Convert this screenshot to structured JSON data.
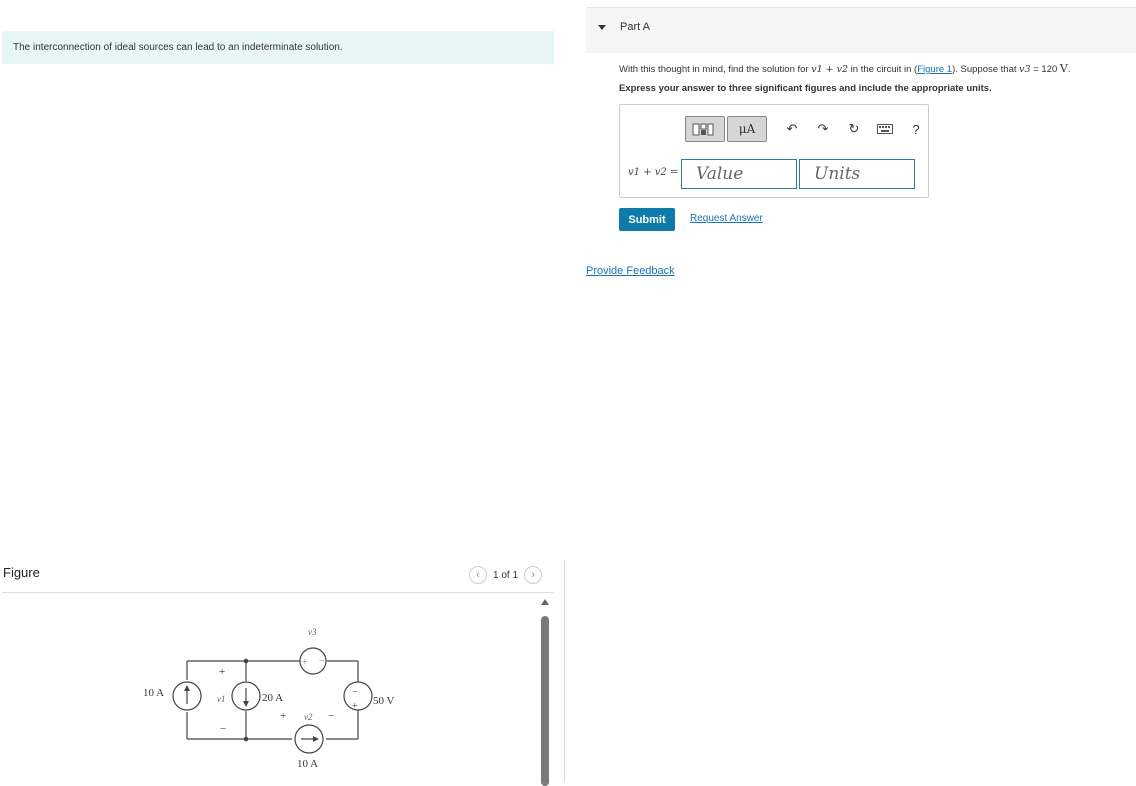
{
  "problem": {
    "intro": "The interconnection of ideal sources can lead to an indeterminate solution."
  },
  "figure": {
    "label": "Figure",
    "pager": "1 of 1",
    "circuit": {
      "labels": {
        "source_10a_left": "10 A",
        "v1_plus": "+",
        "v1": "v1",
        "v1_minus": "−",
        "source_20a": "20 A",
        "v3": "v3",
        "v3_plus": "+",
        "v3_minus": "−",
        "v2_plus": "+",
        "v2": "v2",
        "v2_minus": "−",
        "source_50v": "50 V",
        "s50_minus": "−",
        "s50_plus": "+",
        "source_10a_bottom": "10 A"
      }
    }
  },
  "partA": {
    "title": "Part A",
    "question_prefix": "With this thought in mind, find the solution for ",
    "question_expr": "v1 + v2",
    "question_mid": " in the circuit in (",
    "figure_link": "Figure 1",
    "question_suffix": "). Suppose that ",
    "given_var": "v3",
    "given_value": " = 120 ",
    "given_unit": "V",
    "question_end": ".",
    "instructions": "Express your answer to three significant figures and include the appropriate units.",
    "toolbar": {
      "units_button": "μA",
      "help": "?"
    },
    "answer": {
      "label": "v1 + v2 =",
      "value_placeholder": "Value",
      "units_placeholder": "Units"
    },
    "submit": "Submit",
    "request_answer": "Request Answer"
  },
  "feedback": "Provide Feedback",
  "colors": {
    "accent": "#0f7bab",
    "link": "#1a73b5",
    "intro_bg": "#e9f6f6",
    "input_border": "#2a7ca3"
  }
}
